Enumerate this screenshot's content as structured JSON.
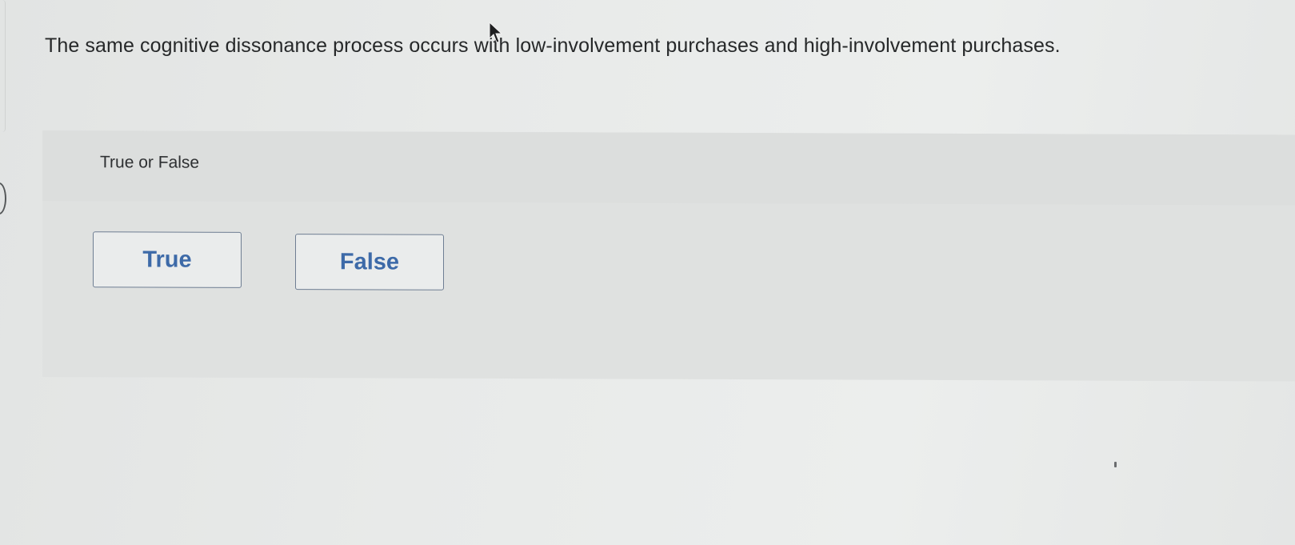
{
  "question": {
    "text": "The same cognitive dissonance process occurs with low-involvement purchases and high-involvement purchases."
  },
  "answer_panel": {
    "prompt": "True or False",
    "choices": [
      {
        "label": "True"
      },
      {
        "label": "False"
      }
    ]
  },
  "colors": {
    "choice_text": "#3d6aa8",
    "choice_border": "#6f7e93",
    "panel_background": "#dfe1e0"
  },
  "icons": {
    "cursor": "mouse-pointer-icon"
  }
}
